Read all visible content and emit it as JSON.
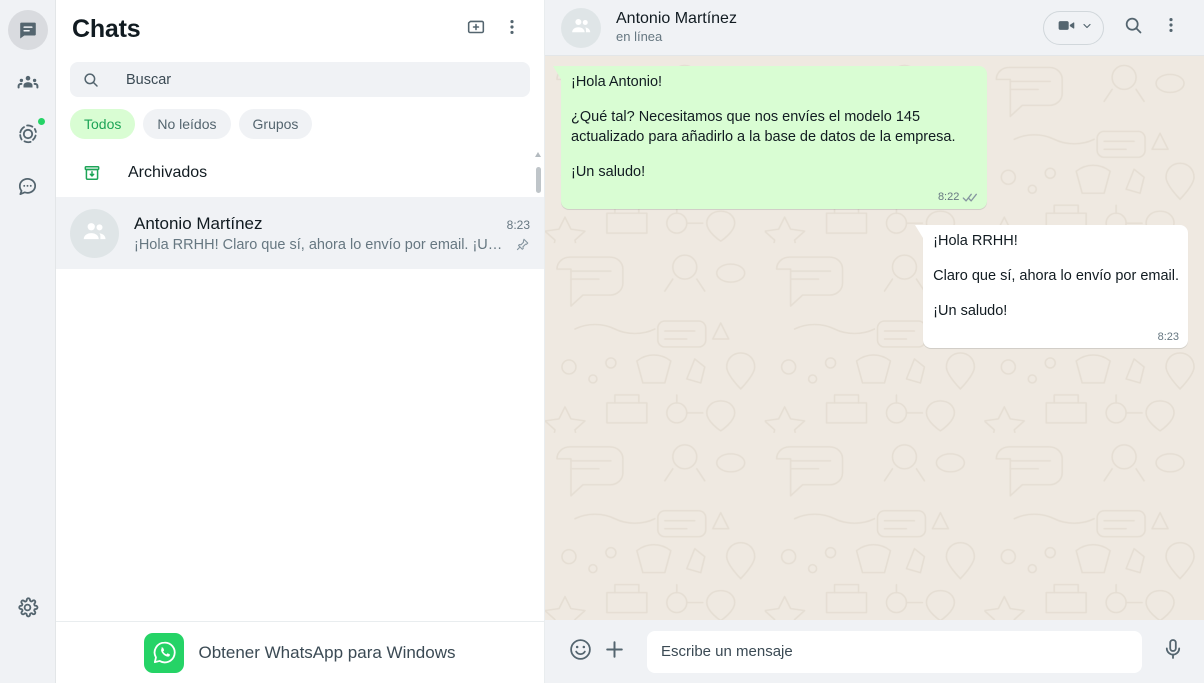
{
  "nav_rail": {
    "items": [
      {
        "name": "chats",
        "icon": "chats-icon",
        "active": true,
        "badge": false
      },
      {
        "name": "status-updates",
        "icon": "communities-icon",
        "active": false,
        "badge": false
      },
      {
        "name": "status",
        "icon": "status-ring-icon",
        "active": false,
        "badge": true
      },
      {
        "name": "channels",
        "icon": "channels-icon",
        "active": false,
        "badge": false
      }
    ],
    "settings": {
      "name": "settings",
      "icon": "gear-icon"
    }
  },
  "chat_list": {
    "title": "Chats",
    "new_chat_icon": "new-chat-icon",
    "menu_icon": "overflow-menu-icon",
    "search": {
      "placeholder": "Buscar",
      "value": "",
      "icon": "search-icon"
    },
    "filters": [
      {
        "label": "Todos",
        "active": true
      },
      {
        "label": "No leídos",
        "active": false
      },
      {
        "label": "Grupos",
        "active": false
      }
    ],
    "archived": {
      "label": "Archivados",
      "icon": "archive-icon"
    },
    "items": [
      {
        "name": "Antonio Martínez",
        "time": "8:23",
        "preview": "¡Hola RRHH! Claro que sí, ahora lo envío por email. ¡Un sa...",
        "pinned": true,
        "selected": true,
        "avatar_icon": "group-avatar-icon"
      }
    ],
    "footer": {
      "label": "Obtener WhatsApp para Windows",
      "icon": "whatsapp-logo-icon"
    }
  },
  "conversation": {
    "header": {
      "name": "Antonio Martínez",
      "status": "en línea",
      "avatar_icon": "group-avatar-icon",
      "video_call_icon": "video-call-icon",
      "video_call_chevron_icon": "chevron-down-icon",
      "search_icon": "search-icon",
      "menu_icon": "overflow-menu-icon"
    },
    "messages": [
      {
        "direction": "in",
        "lines": [
          "¡Hola Antonio!",
          "¿Qué tal? Necesitamos que nos envíes el modelo 145 actualizado para añadirlo a la base de datos de la empresa.",
          "¡Un saludo!"
        ],
        "time": "8:22",
        "status_icon": "double-check-icon",
        "bubble_color": "#d9fdd3"
      },
      {
        "direction": "out",
        "lines": [
          "¡Hola RRHH!",
          "Claro que sí, ahora lo envío por email.",
          "¡Un saludo!"
        ],
        "time": "8:23",
        "status_icon": "",
        "bubble_color": "#ffffff"
      }
    ],
    "composer": {
      "emoji_icon": "emoji-icon",
      "attach_icon": "plus-icon",
      "placeholder": "Escribe un mensaje",
      "value": "",
      "mic_icon": "microphone-icon"
    }
  },
  "colors": {
    "brand_green": "#25d366",
    "accent_green": "#1da457",
    "chat_bg": "#efe9e1",
    "panel_bg": "#f0f2f5",
    "bubble_in": "#d9fdd3",
    "bubble_out": "#ffffff"
  }
}
